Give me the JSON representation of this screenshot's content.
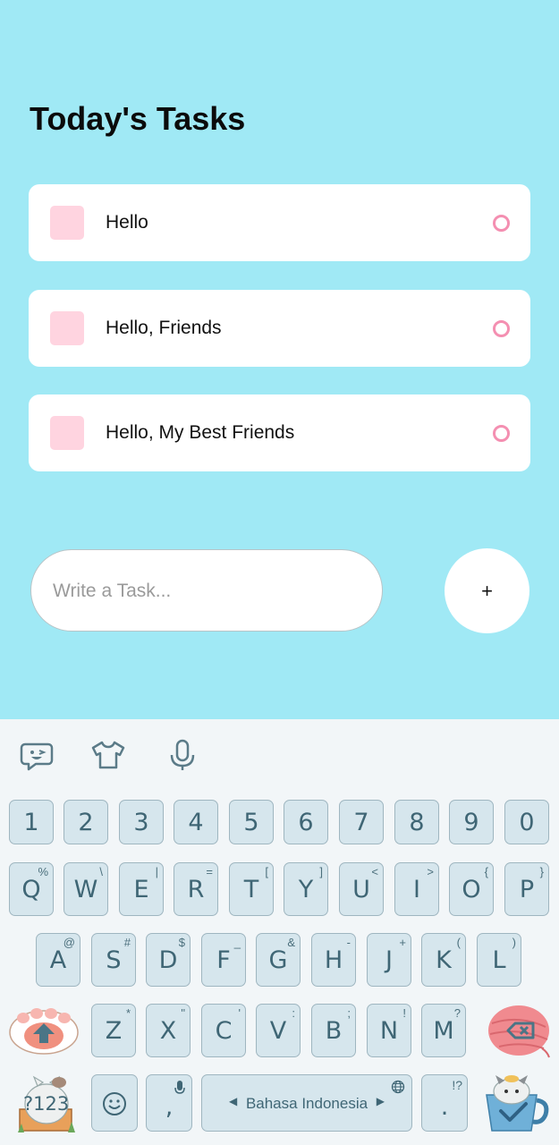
{
  "app": {
    "title": "Today's Tasks",
    "tasks": [
      {
        "label": "Hello"
      },
      {
        "label": "Hello, Friends"
      },
      {
        "label": "Hello, My Best Friends"
      }
    ],
    "input": {
      "placeholder": "Write a Task..."
    },
    "add_button": {
      "label": "+"
    }
  },
  "keyboard": {
    "toolbar": [
      {
        "icon": "emoji-sticker-icon"
      },
      {
        "icon": "theme-shirt-icon"
      },
      {
        "icon": "microphone-icon"
      }
    ],
    "number_row": [
      "1",
      "2",
      "3",
      "4",
      "5",
      "6",
      "7",
      "8",
      "9",
      "0"
    ],
    "row1": [
      {
        "key": "Q",
        "alt": "%"
      },
      {
        "key": "W",
        "alt": "\\"
      },
      {
        "key": "E",
        "alt": "|"
      },
      {
        "key": "R",
        "alt": "="
      },
      {
        "key": "T",
        "alt": "["
      },
      {
        "key": "Y",
        "alt": "]"
      },
      {
        "key": "U",
        "alt": "<"
      },
      {
        "key": "I",
        "alt": ">"
      },
      {
        "key": "O",
        "alt": "{"
      },
      {
        "key": "P",
        "alt": "}"
      }
    ],
    "row2": [
      {
        "key": "A",
        "alt": "@"
      },
      {
        "key": "S",
        "alt": "#"
      },
      {
        "key": "D",
        "alt": "$"
      },
      {
        "key": "F",
        "alt": "_"
      },
      {
        "key": "G",
        "alt": "&"
      },
      {
        "key": "H",
        "alt": "-"
      },
      {
        "key": "J",
        "alt": "+"
      },
      {
        "key": "K",
        "alt": "("
      },
      {
        "key": "L",
        "alt": ")"
      }
    ],
    "row3": [
      {
        "key": "Z",
        "alt": "*"
      },
      {
        "key": "X",
        "alt": "\""
      },
      {
        "key": "C",
        "alt": "'"
      },
      {
        "key": "V",
        "alt": ":"
      },
      {
        "key": "B",
        "alt": ";"
      },
      {
        "key": "N",
        "alt": "!"
      },
      {
        "key": "M",
        "alt": "?"
      }
    ],
    "symbols_key": "?123",
    "comma": ",",
    "space_label": "Bahasa Indonesia",
    "period": ".",
    "period_alt": "!?",
    "colors": {
      "accent_pink": "#f48fb1",
      "app_bg": "#a0e9f5",
      "key_bg": "#d6e6ed"
    }
  }
}
